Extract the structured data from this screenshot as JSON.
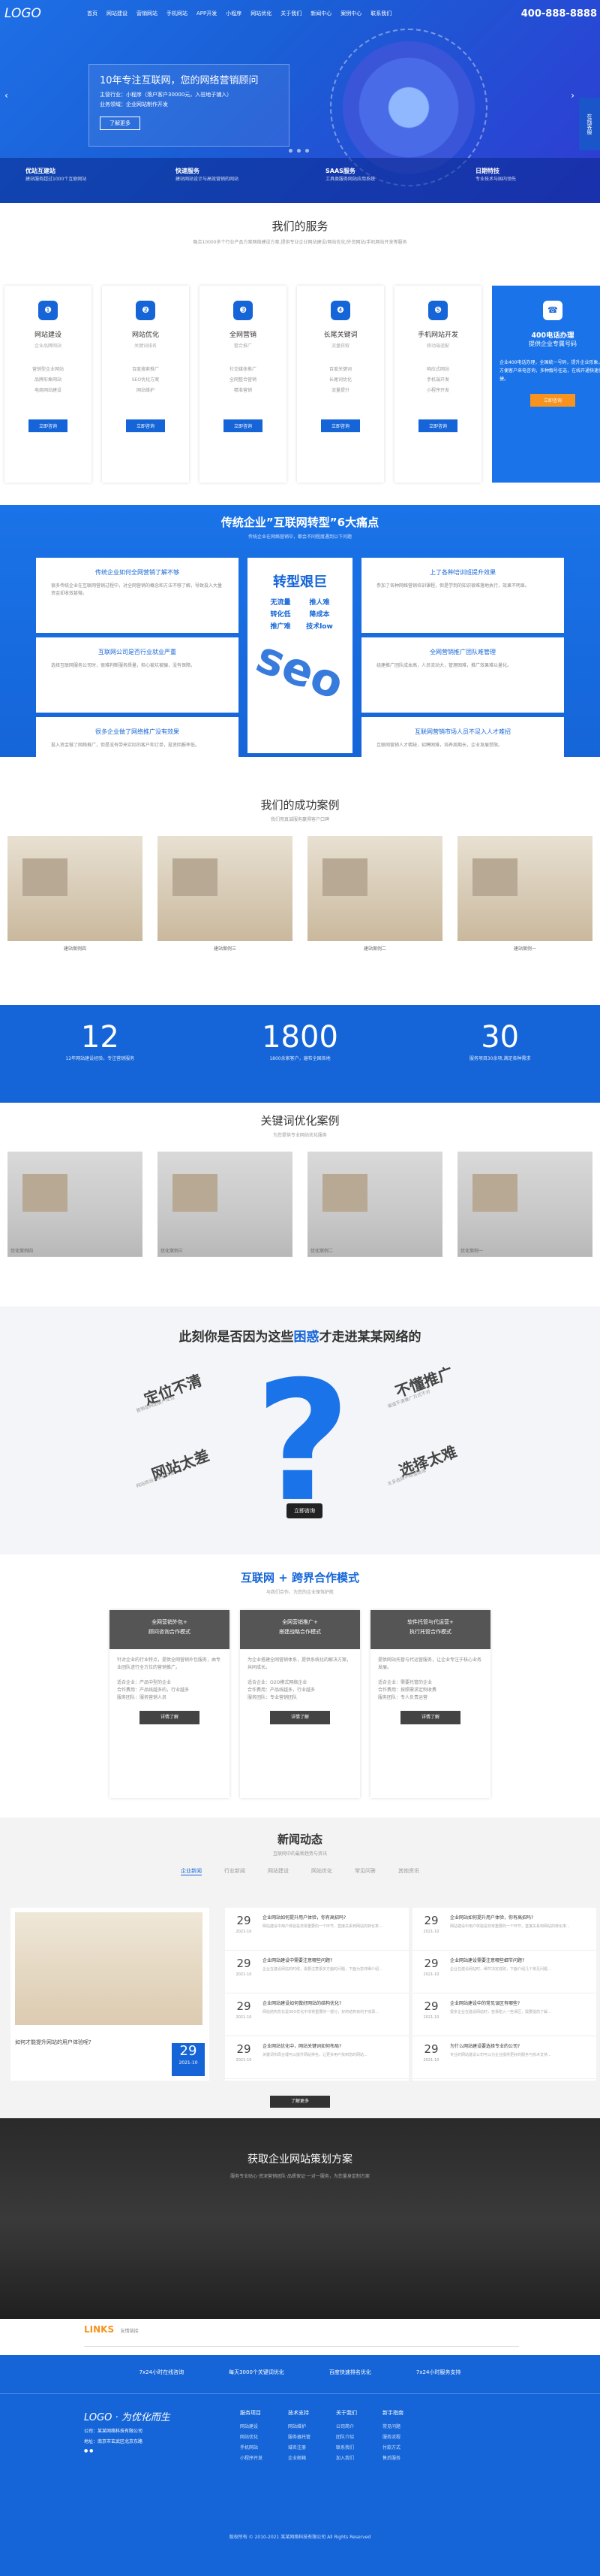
{
  "header": {
    "logo": "LOGO",
    "phone": "400-888-8888",
    "nav": [
      "首页",
      "网站建设",
      "营销网站",
      "手机网站",
      "APP开发",
      "小程序",
      "网站优化",
      "关于我们",
      "新闻中心",
      "案例中心",
      "联系我们"
    ],
    "sidebar": "在线客服"
  },
  "banner": {
    "title": "10年专注互联网，您的网络营销顾问",
    "line1": "主营行业：小程序（落户客户30000元，入驻地子铺入）",
    "line2": "业务领域：企业网站制作开发",
    "btn": "了解更多"
  },
  "features": [
    {
      "t": "优站互建站",
      "d": "建站服务超过1000个互联网站"
    },
    {
      "t": "快速服务",
      "d": "建站网站设计与高效营销的网站"
    },
    {
      "t": "SAAS服务",
      "d": "工具类服务网站应用系统"
    },
    {
      "t": "日期特技",
      "d": "专业技术与国内领先"
    }
  ],
  "services": {
    "title": "我们的服务",
    "sub": "融合10000多个行业产品方案网络建设方案,提供专业企业网站建设/网站优化/外贸网站/手机网站开发等服务",
    "cards": [
      {
        "icon": "❶",
        "t": "网站建设",
        "d": "企业品牌网站",
        "items": [
          "营销型企业网站",
          "品牌形象网站",
          "电商网站建设"
        ],
        "btn": "立即咨询"
      },
      {
        "icon": "❷",
        "t": "网站优化",
        "d": "关键词排名",
        "items": [
          "百度搜索推广",
          "SEO优化方案",
          "网站维护"
        ],
        "btn": "立即咨询"
      },
      {
        "icon": "❸",
        "t": "全网营销",
        "d": "整合推广",
        "items": [
          "社交媒体推广",
          "全网整合营销",
          "精准营销"
        ],
        "btn": "立即咨询"
      },
      {
        "icon": "❹",
        "t": "长尾关键词",
        "d": "流量获取",
        "items": [
          "百度关键词",
          "长尾词优化",
          "流量提升"
        ],
        "btn": "立即咨询"
      },
      {
        "icon": "❺",
        "t": "手机网站开发",
        "d": "移动端适配",
        "items": [
          "响应式网站",
          "手机端开发",
          "小程序开发"
        ],
        "btn": "立即咨询"
      }
    ],
    "hotline": {
      "icon": "☎",
      "t": "400电话办理",
      "d": "提供企业专属号码",
      "text": "企业400电话办理，全国统一号码，提升企业形象，方便客户来电咨询，多种靓号任选，在线开通快速便捷。",
      "btn": "立即咨询"
    }
  },
  "pain": {
    "title": "传统企业”互联网转型”6大痛点",
    "sub": "传统企业在网络营销中，都会不同程度遇到以下问题",
    "center": {
      "t": "转型艰巨",
      "kw": [
        "无流量",
        "推人难",
        "转化低",
        "降成本",
        "推广难",
        "技术low"
      ],
      "seo": "seo"
    },
    "boxes": [
      {
        "t": "传统企业如何全网营销了解不够",
        "d": "很多传统企业在互联网营销过程中，对全网营销的概念和方法不够了解，导致投入大量资金却收效甚微。"
      },
      {
        "t": "上了各种培训班提升效果",
        "d": "参加了各种网络营销培训课程，但是学到的知识很难落地执行，效果不明显。"
      },
      {
        "t": "互联网公司是否行业就业严重",
        "d": "选择互联网服务公司时，很难判断服务质量，担心被坑被骗，没有保障。"
      },
      {
        "t": "全网营销推广团队难管理",
        "d": "组建推广团队成本高，人员流动大，管理困难，推广效果难以量化。"
      },
      {
        "t": "很多企业做了网络推广没有效果",
        "d": "投入资金做了网络推广，但是没有带来实际的客户和订单，投资回报率低。"
      },
      {
        "t": "互联网营销市场人员不足入人才难招",
        "d": "互联网营销人才稀缺，招聘困难，培养周期长，企业发展受限。"
      }
    ]
  },
  "cases": {
    "title": "我们的成功案例",
    "sub": "我们用真诚服务赢得客户口碑",
    "items": [
      "建站案例四",
      "建站案例三",
      "建站案例二",
      "建站案例一"
    ]
  },
  "stats": [
    {
      "n": "12",
      "d": "12年网站建设经验，专注营销服务"
    },
    {
      "n": "1800",
      "d": "1800余家客户，遍布全国各地"
    },
    {
      "n": "30",
      "d": "服务项目30余项,满足各种需求"
    }
  ],
  "kwcases": {
    "title": "关键词优化案例",
    "sub": "为您提供专业网站优化服务",
    "items": [
      "优化案例四",
      "优化案例三",
      "优化案例二",
      "优化案例一"
    ]
  },
  "trouble": {
    "pre": "此刻你是否因为这些",
    "hl": "困惑",
    "post": "才走进某某网络的",
    "labels": [
      "定位不清",
      "网站太差",
      "不懂推广",
      "选择太难"
    ],
    "subs": [
      "营销型网站客户定位",
      "网站陈旧与老旧体验",
      "渠道不清推广方式不对",
      "太多选择不知道选谁"
    ],
    "pill": "立即咨询"
  },
  "coop": {
    "title": "互联网 + 跨界合作模式",
    "sub": "与我们合作，为您的企业保驾护航",
    "cards": [
      {
        "h1": "全网营销外包+",
        "h2": "顾问咨询合作模式",
        "d": "针对企业的行业特点，提供全网营销外包服务，由专业团队进行全方位的营销推广。",
        "list": "适合企业：产品中型的企业\n合作费用：产品线越多的，行业越多\n服务团队：服务营销人员",
        "btn": "详情了解"
      },
      {
        "h1": "全网营销推广+",
        "h2": "搭建战略合作模式",
        "d": "为企业搭建全网营销体系，提供系统化的解决方案，共同成长。",
        "list": "适合企业：O2O模式网络企业\n合作费用：产品线越多，行业越多\n服务团队：专业营销团队",
        "btn": "详情了解"
      },
      {
        "h1": "软件托管与代运营+",
        "h2": "执行托管合作模式",
        "d": "提供网站托管与代运营服务，让企业专注于核心业务发展。",
        "list": "适合企业：需要托管的企业\n合作费用：按照需求定制收费\n服务团队：专人负责运营",
        "btn": "详情了解"
      }
    ]
  },
  "news": {
    "title": "新闻动态",
    "sub": "互联网中的最新趋势与资讯",
    "tabs": [
      "企业新闻",
      "行业新闻",
      "网站建设",
      "网站优化",
      "常见问答",
      "其他资讯"
    ],
    "featured": {
      "title": "如何才能提升网站的用户体验呢?",
      "day": "29",
      "ym": "2021-10"
    },
    "items": [
      {
        "day": "29",
        "ym": "2021-10",
        "t": "企业网站如何提升用户体验，你有高招吗?",
        "d": "网站建设中用户体验是非常重要的一个环节，直接关系到网站的转化率..."
      },
      {
        "day": "29",
        "ym": "2021-10",
        "t": "企业网站建设中需要注意哪些问题?",
        "d": "企业在建设网站的时候，需要注意很多方面的问题，下面为您详细介绍..."
      },
      {
        "day": "29",
        "ym": "2021-10",
        "t": "企业网站建设如何做好网站的结构优化?",
        "d": "网站结构优化是SEO优化中非常重要的一部分，好的结构有利于收录..."
      },
      {
        "day": "29",
        "ym": "2021-10",
        "t": "企业网站优化中，网站关键词如何布局?",
        "d": "关键词布局合理可以提升网站排名，让更多用户找到您的网站..."
      },
      {
        "day": "29",
        "ym": "2021-10",
        "t": "企业网站如何提升用户体验，你有高招吗?",
        "d": "网站建设中用户体验是非常重要的一个环节，直接关系到网站的转化率..."
      },
      {
        "day": "29",
        "ym": "2021-10",
        "t": "企业网站建设需要注意哪些细节问题?",
        "d": "企业在建设网站时，细节决定成败，下面介绍几个常见问题..."
      },
      {
        "day": "29",
        "ym": "2021-10",
        "t": "企业网站建设中的常见误区有哪些?",
        "d": "很多企业在建设网站时，容易陷入一些误区，需要提前了解..."
      },
      {
        "day": "29",
        "ym": "2021-10",
        "t": "为什么网站建设要选择专业的公司?",
        "d": "专业的网站建设公司可以为企业提供更好的服务与技术支持..."
      }
    ],
    "more": "了解更多"
  },
  "plan": {
    "title": "获取企业网站策划方案",
    "sub": "服务专业贴心·资深营销团队·品质保证·一对一服务，为您量身定制方案"
  },
  "links": {
    "title": "LINKS",
    "label": "友情链接"
  },
  "footer": {
    "bar": [
      "7x24小时在线咨询",
      "每天3000个关键词优化",
      "百度快速排名优化",
      "7x24小时服务支持"
    ],
    "brand": "LOGO · 为优化而生",
    "company": "公司：某某网络科技有限公司",
    "addr": "地址：南京市玄武区北京东路",
    "cols": [
      {
        "h": "服务项目",
        "i": [
          "网站建设",
          "网站优化",
          "手机网站",
          "小程序开发"
        ]
      },
      {
        "h": "技术支持",
        "i": [
          "网站维护",
          "服务器托管",
          "域名注册",
          "企业邮箱"
        ]
      },
      {
        "h": "关于我们",
        "i": [
          "公司简介",
          "团队介绍",
          "联系我们",
          "加入我们"
        ]
      },
      {
        "h": "新手指南",
        "i": [
          "常见问题",
          "服务流程",
          "付款方式",
          "售后服务"
        ]
      }
    ],
    "copy": "版权所有 © 2010-2021 某某网络科技有限公司 All Rights Reserved"
  }
}
